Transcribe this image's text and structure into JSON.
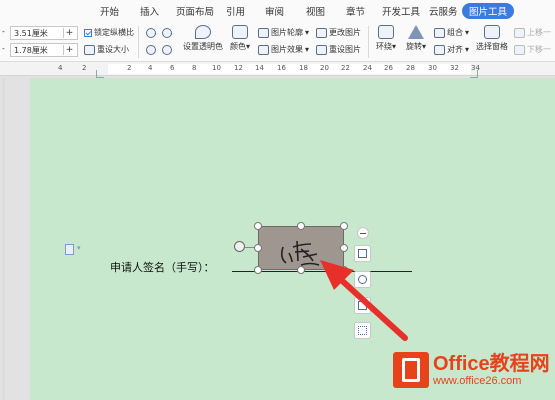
{
  "menu": {
    "tabs": [
      "开始",
      "插入",
      "页面布局",
      "引用",
      "审阅",
      "视图",
      "章节",
      "开发工具",
      "云服务",
      "图片工具"
    ]
  },
  "size": {
    "width": "3.51厘米",
    "height": "1.78厘米",
    "plus": "+",
    "minus": "-",
    "lock_ratio": "锁定纵横比",
    "reset_size": "重设大小"
  },
  "ribbon": {
    "transparent": "设置透明色",
    "color": "颜色",
    "outline": "图片轮廓",
    "effect": "图片效果",
    "change": "更改图片",
    "reset": "重设图片",
    "wrap": "环绕",
    "rotate": "旋转",
    "group": "组合",
    "align": "对齐",
    "select_pane": "选择窗格",
    "bring_forward": "上移一",
    "send_backward": "下移一",
    "dropdown": "▾"
  },
  "ruler": {
    "labels": [
      "4",
      "2",
      "2",
      "4",
      "6",
      "8",
      "10",
      "12",
      "14",
      "16",
      "18",
      "20",
      "22",
      "24",
      "26",
      "28",
      "30",
      "32",
      "34"
    ]
  },
  "document": {
    "label": "申请人签名（手写）：",
    "doc_caret": "▾"
  },
  "signature": {
    "glyph": "小李"
  },
  "watermark": {
    "title": "Office教程网",
    "url": "www.office26.com"
  },
  "colors": {
    "accent": "#3b7be0",
    "page": "#c7e8cc",
    "arrow": "#e8302a",
    "watermark": "#e8421b"
  }
}
